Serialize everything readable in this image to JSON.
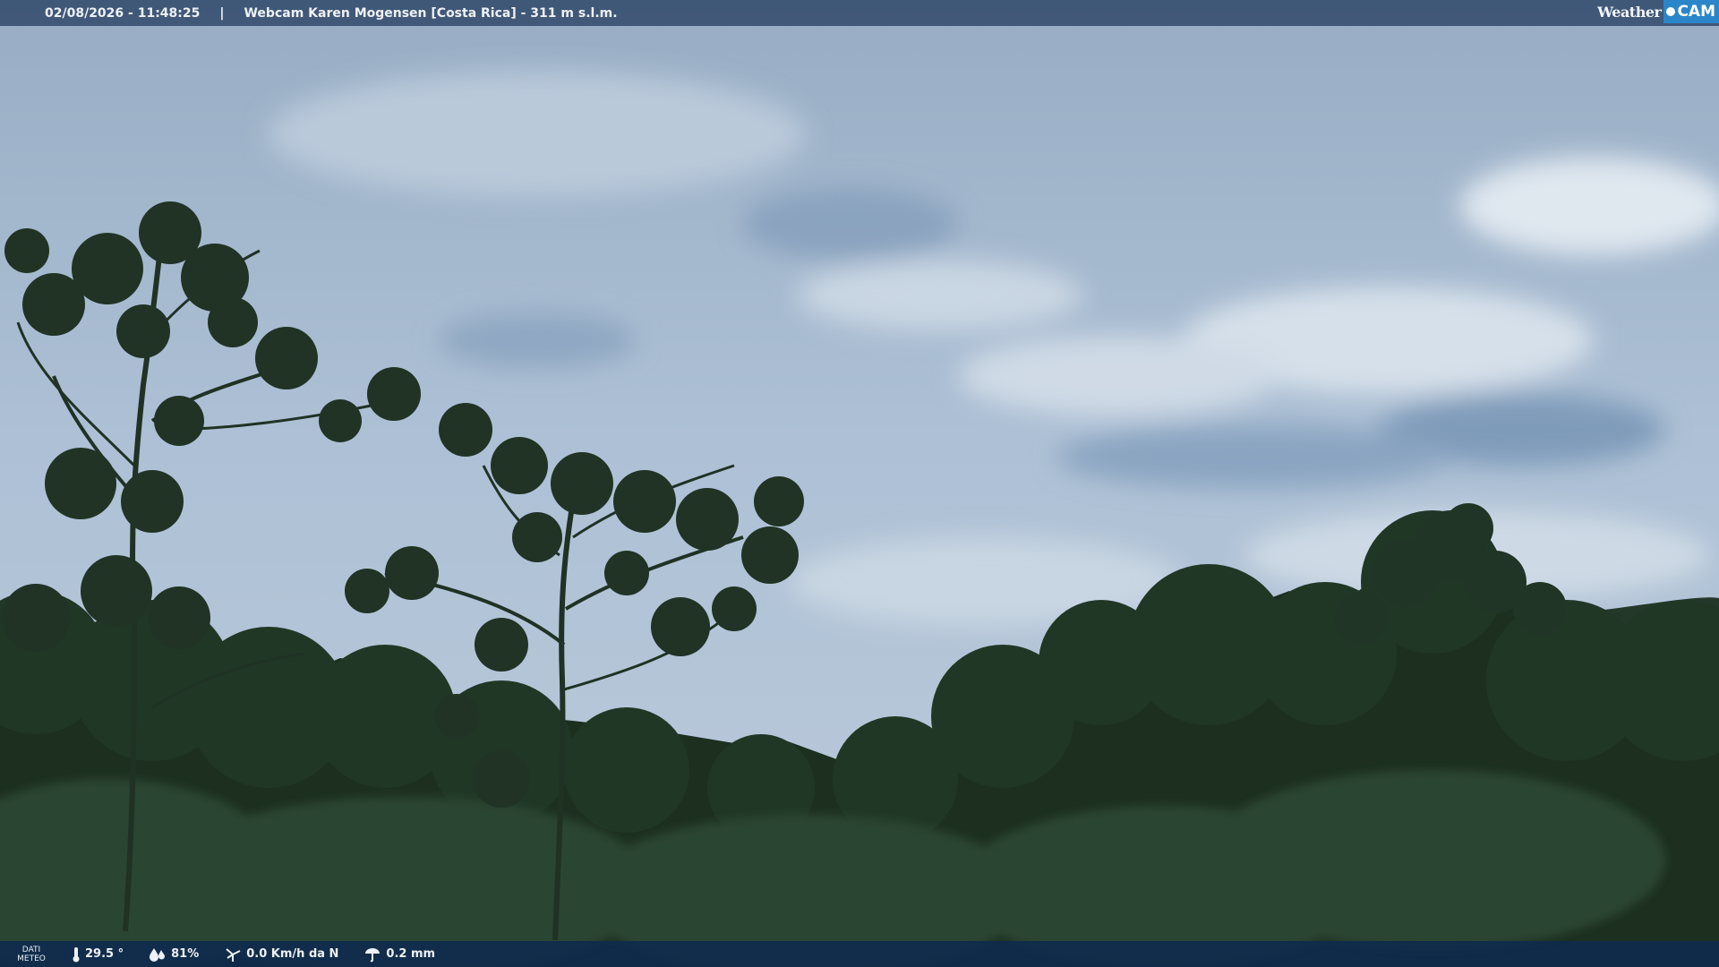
{
  "header": {
    "timestamp": "02/08/2026 - 11:48:25",
    "separator": "|",
    "title": "Webcam Karen Mogensen [Costa Rica]  - 311 m s.l.m.",
    "logo_weather": "Weather",
    "logo_cam": "CAM"
  },
  "footer": {
    "label_line1": "DATI",
    "label_line2": "METEO",
    "temperature": "29.5 °",
    "humidity": "81%",
    "wind": "0.0 Km/h da N",
    "rain": "0.2 mm",
    "icons": [
      "thermometer-icon",
      "humidity-icon",
      "wind-icon",
      "rain-icon"
    ]
  },
  "colors": {
    "bar": "#1e375a",
    "logo_accent": "#2b86c9",
    "sky": "#a9bdd2",
    "foliage": "#1f3322"
  }
}
